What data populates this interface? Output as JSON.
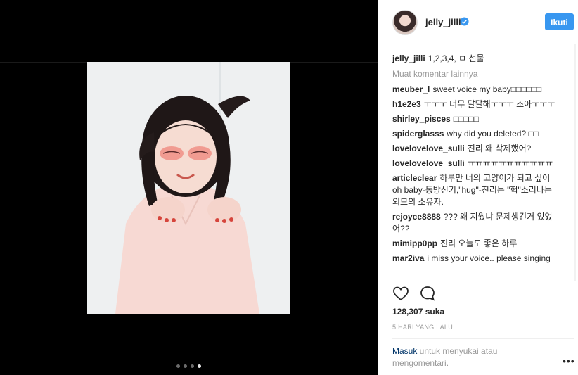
{
  "header": {
    "username": "jelly_jilli",
    "follow_label": "Ikuti"
  },
  "caption": {
    "username": "jelly_jilli",
    "text": "1,2,3,4, ㅁ 선물"
  },
  "more_comments_label": "Muat komentar lainnya",
  "comments": [
    {
      "user": "meuber_l",
      "text": "sweet voice my baby□□□□□□"
    },
    {
      "user": "h1e2e3",
      "text": "ㅜㅜㅜ 너무 달달해ㅜㅜㅜ 조아ㅜㅜㅜ"
    },
    {
      "user": "shirley_pisces",
      "text": "□□□□□"
    },
    {
      "user": "spiderglasss",
      "text": "why did you deleted? □□"
    },
    {
      "user": "lovelovelove_sulli",
      "text": "진리 왜 삭제했어?"
    },
    {
      "user": "lovelovelove_sulli",
      "text": "ㅠㅠㅠㅠㅠㅠㅠㅠㅠㅠㅠ"
    },
    {
      "user": "articleclear",
      "text": "하루만 너의 고양이가 되고 싶어 oh baby-동방신기,\"hug\"-진리는 \"헉\"소리나는 외모의 소유자."
    },
    {
      "user": "rejoyce8888",
      "text": "??? 왜 지웠냐 문제생긴거 있었어??"
    },
    {
      "user": "mimipp0pp",
      "text": "진리 오늘도 좋은 하루"
    },
    {
      "user": "mar2iva",
      "text": "i miss your voice.. please singing"
    }
  ],
  "likes_text": "128,307 suka",
  "date_text": "5 HARI YANG LALU",
  "login": {
    "link_label": "Masuk",
    "rest_text": " untuk menyukai atau mengomentari."
  },
  "icons": {
    "like": "heart-icon",
    "comment": "comment-bubble-icon",
    "verified": "verified-badge-icon",
    "options": "more-options-icon"
  },
  "colors": {
    "follow_button": "#3897f0",
    "verified": "#3897f0",
    "link": "#003569"
  },
  "carousel": {
    "total": 4,
    "active": 4
  }
}
